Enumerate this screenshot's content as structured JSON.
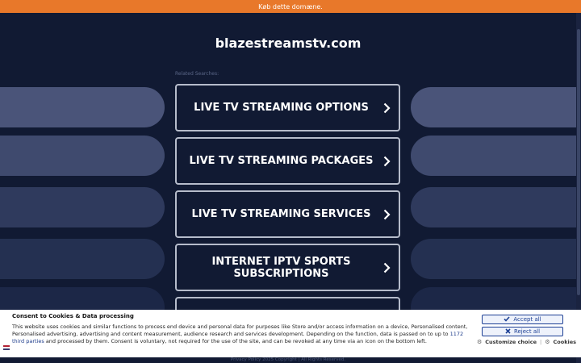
{
  "topbar": {
    "text": "Køb dette domæne."
  },
  "site": {
    "title": "blazestreamstv.com"
  },
  "related_label": "Related Searches:",
  "searches": [
    {
      "label": "LIVE TV STREAMING OPTIONS"
    },
    {
      "label": "LIVE TV STREAMING PACKAGES"
    },
    {
      "label": "LIVE TV STREAMING SERVICES"
    },
    {
      "label": "INTERNET IPTV SPORTS SUBSCRIPTIONS"
    },
    {
      "label": ""
    }
  ],
  "cookie": {
    "title": "Consent to Cookies & Data processing",
    "text_before_link": "This website uses cookies and similar functions to process end device and personal data for purposes like Store and/or access information on a device, Personalised content, Personalised advertising, advertising and content measurement, audience research and services development. Depending on the function, data is passed on to up to ",
    "link_text": "1172 third parties",
    "text_after_link": " and processed by them. Consent is voluntary, not required for the use of the site, and can be revoked at any time via an icon on the bottom left.",
    "accept_label": "Accept all",
    "reject_label": "Reject all",
    "customize_label": "Customize choice",
    "separator": "|",
    "cookies_label": "Cookies"
  },
  "footer": {
    "text": "Privacy Policy   2025 Copyright | All Rights Reserved."
  },
  "colors": {
    "topbar": "#e8782a",
    "background": "#111a33",
    "accent": "#1c3f94"
  }
}
